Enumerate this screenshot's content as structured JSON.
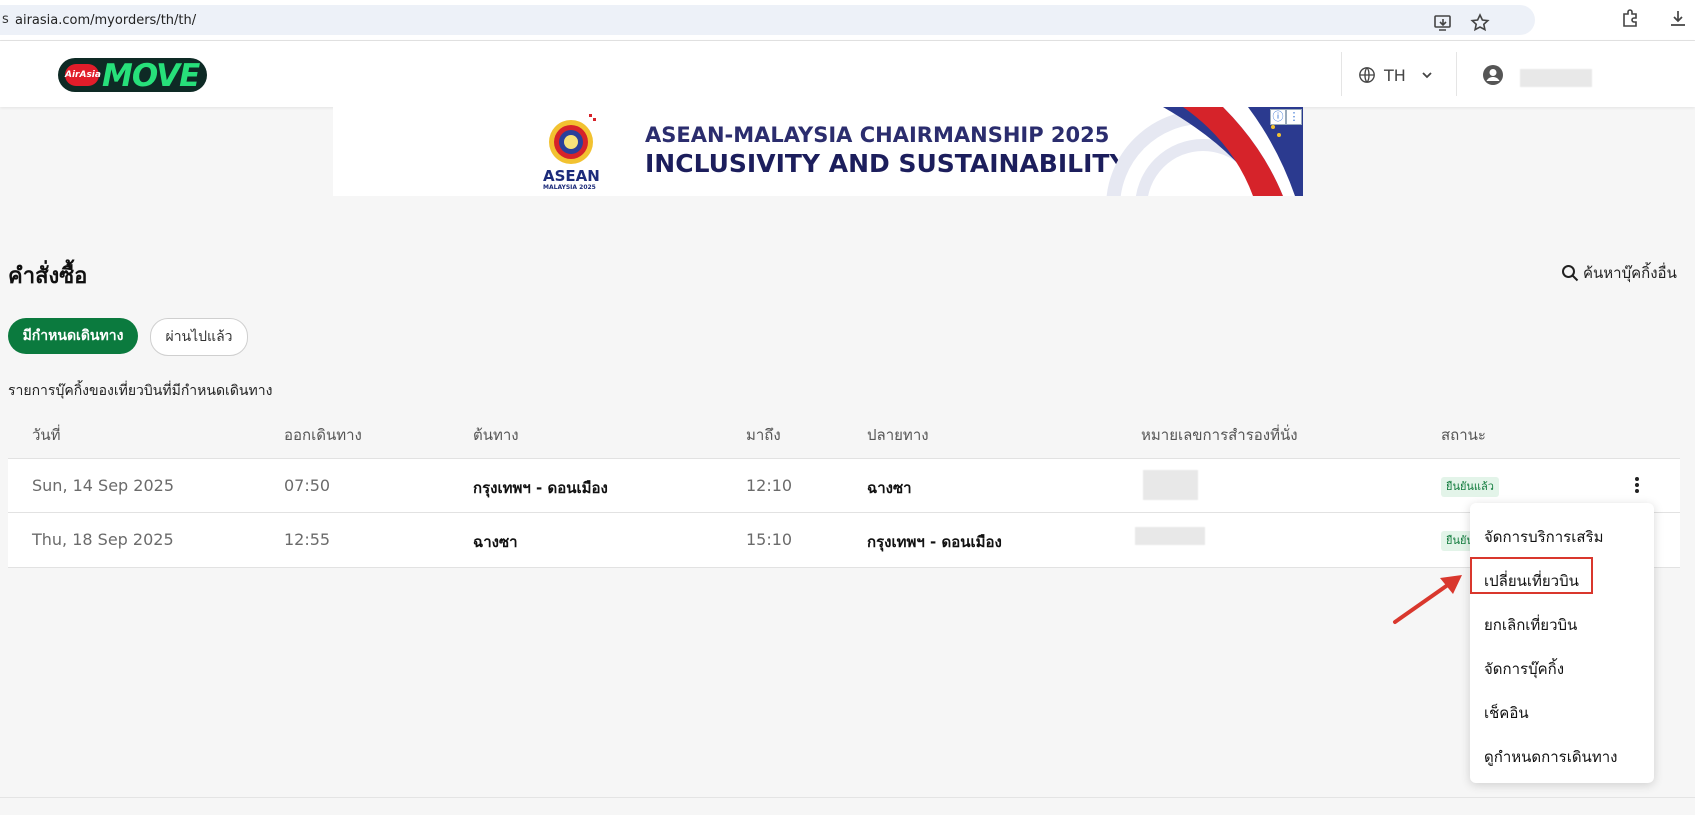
{
  "browser": {
    "lead_glyph": "s",
    "url": "airasia.com/myorders/th/th/"
  },
  "header": {
    "logo_small": "AirAsia",
    "logo_text": "MOVE",
    "language": "TH"
  },
  "banner": {
    "emblem_text": "ASEAN",
    "emblem_sub": "MALAYSIA 2025",
    "line1": "ASEAN-MALAYSIA CHAIRMANSHIP 2025",
    "line2": "INCLUSIVITY AND SUSTAINABILITY",
    "ad_info": "ⓘ",
    "ad_more": "⋮"
  },
  "page": {
    "title": "คำสั่งซื้อ",
    "search_link": "ค้นหาบุ๊คกิ้งอื่น",
    "tabs": [
      {
        "label": "มีกำหนดเดินทาง",
        "active": true
      },
      {
        "label": "ผ่านไปแล้ว",
        "active": false
      }
    ],
    "list_caption": "รายการบุ๊คกิ้งของเที่ยวบินที่มีกำหนดเดินทาง"
  },
  "table": {
    "columns": [
      "วันที่",
      "ออกเดินทาง",
      "ต้นทาง",
      "มาถึง",
      "ปลายทาง",
      "หมายเลขการสำรองที่นั่ง",
      "สถานะ"
    ],
    "rows": [
      {
        "date": "Sun, 14 Sep 2025",
        "depart": "07:50",
        "origin": "กรุงเทพฯ - ดอนเมือง",
        "arrive": "12:10",
        "destination": "ฉางซา",
        "status": "ยืนยันแล้ว"
      },
      {
        "date": "Thu, 18 Sep 2025",
        "depart": "12:55",
        "origin": "ฉางซา",
        "arrive": "15:10",
        "destination": "กรุงเทพฯ - ดอนเมือง",
        "status": "ยืนยัน"
      }
    ]
  },
  "menu": {
    "items": [
      "จัดการบริการเสริม",
      "เปลี่ยนเที่ยวบิน",
      "ยกเลิกเที่ยวบิน",
      "จัดการบุ๊คกิ้ง",
      "เช็คอิน",
      "ดูกำหนดการเดินทาง"
    ],
    "highlighted_item": "เปลี่ยนเที่ยวบิน"
  },
  "colors": {
    "brand_green": "#0b7a3e",
    "badge_bg": "#e3f4e9",
    "annotation_red": "#d9372d"
  }
}
